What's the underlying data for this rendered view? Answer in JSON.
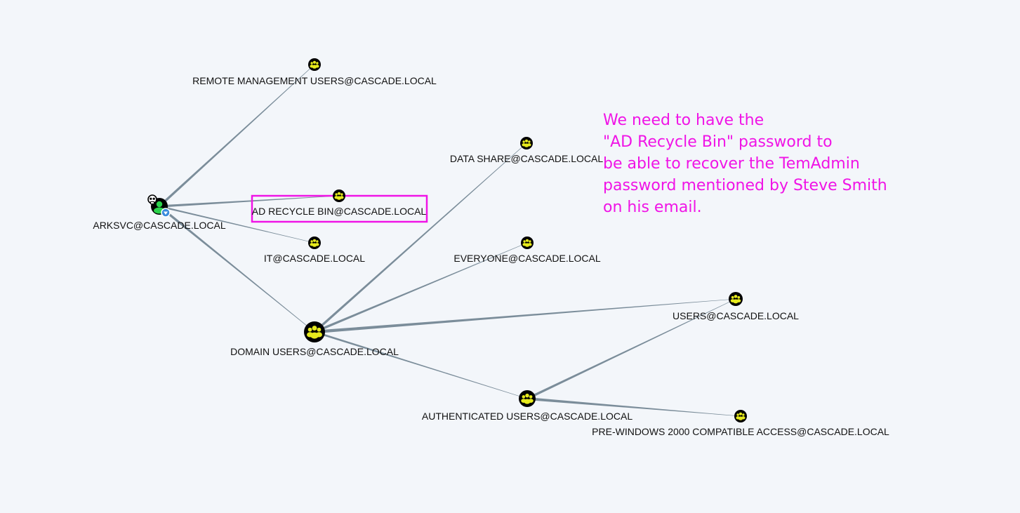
{
  "colors": {
    "background": "#f3f6fa",
    "edge": "#7b8d9a",
    "group_icon_ring": "#000000",
    "group_icon_fill": "#e6ea1d",
    "highlight_box": "#f014e6",
    "annotation_text": "#f014e6",
    "user_green": "#2bd24b",
    "badge_blue": "#3a8bdc"
  },
  "nodes": {
    "remote_mgmt": {
      "label": "REMOTE MANAGEMENT USERS@CASCADE.LOCAL",
      "icon": "group-icon"
    },
    "arksvc": {
      "label": "ARKSVC@CASCADE.LOCAL",
      "icon": "user-icon"
    },
    "ad_recycle": {
      "label": "AD RECYCLE BIN@CASCADE.LOCAL",
      "icon": "group-icon"
    },
    "it": {
      "label": "IT@CASCADE.LOCAL",
      "icon": "group-icon"
    },
    "data_share": {
      "label": "DATA SHARE@CASCADE.LOCAL",
      "icon": "group-icon"
    },
    "everyone": {
      "label": "EVERYONE@CASCADE.LOCAL",
      "icon": "group-icon"
    },
    "domain_users": {
      "label": "DOMAIN USERS@CASCADE.LOCAL",
      "icon": "group-icon"
    },
    "users": {
      "label": "USERS@CASCADE.LOCAL",
      "icon": "group-icon"
    },
    "auth_users": {
      "label": "AUTHENTICATED USERS@CASCADE.LOCAL",
      "icon": "group-icon"
    },
    "pre_win2000": {
      "label": "PRE-WINDOWS 2000 COMPATIBLE ACCESS@CASCADE.LOCAL",
      "icon": "group-icon"
    }
  },
  "edges": [
    {
      "from": "arksvc",
      "to": "remote_mgmt"
    },
    {
      "from": "arksvc",
      "to": "ad_recycle"
    },
    {
      "from": "arksvc",
      "to": "it"
    },
    {
      "from": "arksvc",
      "to": "domain_users"
    },
    {
      "from": "domain_users",
      "to": "data_share"
    },
    {
      "from": "domain_users",
      "to": "everyone"
    },
    {
      "from": "domain_users",
      "to": "users"
    },
    {
      "from": "domain_users",
      "to": "auth_users"
    },
    {
      "from": "auth_users",
      "to": "users"
    },
    {
      "from": "auth_users",
      "to": "pre_win2000"
    }
  ],
  "annotation": {
    "text": "We need to have the\n\"AD Recycle Bin\" password to\nbe able to recover the TemAdmin\npassword mentioned by Steve Smith\non his email."
  },
  "highlight": {
    "target": "ad_recycle"
  }
}
